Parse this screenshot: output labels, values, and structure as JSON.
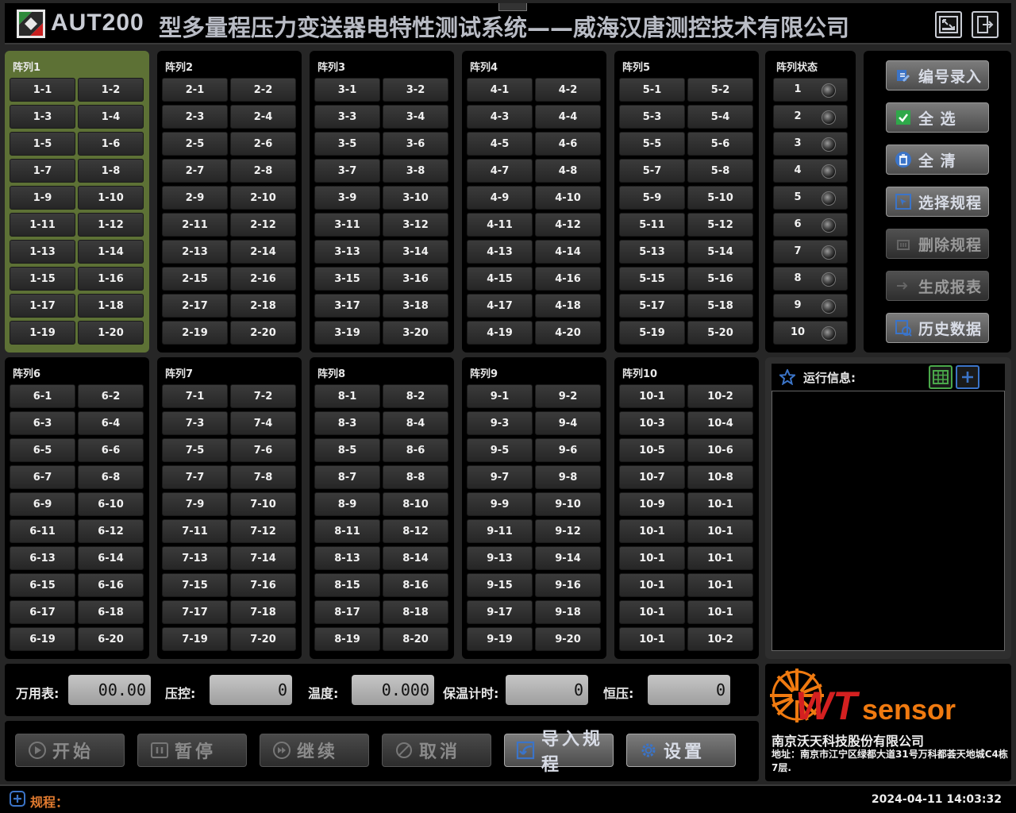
{
  "header": {
    "app_name": "AUT200",
    "title": "型多量程压力变送器电特性测试系统——威海汉唐测控技术有限公司"
  },
  "arrays": [
    {
      "title": "阵列1",
      "active": true,
      "cells": [
        "1-1",
        "1-2",
        "1-3",
        "1-4",
        "1-5",
        "1-6",
        "1-7",
        "1-8",
        "1-9",
        "1-10",
        "1-11",
        "1-12",
        "1-13",
        "1-14",
        "1-15",
        "1-16",
        "1-17",
        "1-18",
        "1-19",
        "1-20"
      ]
    },
    {
      "title": "阵列2",
      "active": false,
      "cells": [
        "2-1",
        "2-2",
        "2-3",
        "2-4",
        "2-5",
        "2-6",
        "2-7",
        "2-8",
        "2-9",
        "2-10",
        "2-11",
        "2-12",
        "2-13",
        "2-14",
        "2-15",
        "2-16",
        "2-17",
        "2-18",
        "2-19",
        "2-20"
      ]
    },
    {
      "title": "阵列3",
      "active": false,
      "cells": [
        "3-1",
        "3-2",
        "3-3",
        "3-4",
        "3-5",
        "3-6",
        "3-7",
        "3-8",
        "3-9",
        "3-10",
        "3-11",
        "3-12",
        "3-13",
        "3-14",
        "3-15",
        "3-16",
        "3-17",
        "3-18",
        "3-19",
        "3-20"
      ]
    },
    {
      "title": "阵列4",
      "active": false,
      "cells": [
        "4-1",
        "4-2",
        "4-3",
        "4-4",
        "4-5",
        "4-6",
        "4-7",
        "4-8",
        "4-9",
        "4-10",
        "4-11",
        "4-12",
        "4-13",
        "4-14",
        "4-15",
        "4-16",
        "4-17",
        "4-18",
        "4-19",
        "4-20"
      ]
    },
    {
      "title": "阵列5",
      "active": false,
      "cells": [
        "5-1",
        "5-2",
        "5-3",
        "5-4",
        "5-5",
        "5-6",
        "5-7",
        "5-8",
        "5-9",
        "5-10",
        "5-11",
        "5-12",
        "5-13",
        "5-14",
        "5-15",
        "5-16",
        "5-17",
        "5-18",
        "5-19",
        "5-20"
      ]
    },
    {
      "title": "阵列6",
      "active": false,
      "cells": [
        "6-1",
        "6-2",
        "6-3",
        "6-4",
        "6-5",
        "6-6",
        "6-7",
        "6-8",
        "6-9",
        "6-10",
        "6-11",
        "6-12",
        "6-13",
        "6-14",
        "6-15",
        "6-16",
        "6-17",
        "6-18",
        "6-19",
        "6-20"
      ]
    },
    {
      "title": "阵列7",
      "active": false,
      "cells": [
        "7-1",
        "7-2",
        "7-3",
        "7-4",
        "7-5",
        "7-6",
        "7-7",
        "7-8",
        "7-9",
        "7-10",
        "7-11",
        "7-12",
        "7-13",
        "7-14",
        "7-15",
        "7-16",
        "7-17",
        "7-18",
        "7-19",
        "7-20"
      ]
    },
    {
      "title": "阵列8",
      "active": false,
      "cells": [
        "8-1",
        "8-2",
        "8-3",
        "8-4",
        "8-5",
        "8-6",
        "8-7",
        "8-8",
        "8-9",
        "8-10",
        "8-11",
        "8-12",
        "8-13",
        "8-14",
        "8-15",
        "8-16",
        "8-17",
        "8-18",
        "8-19",
        "8-20"
      ]
    },
    {
      "title": "阵列9",
      "active": false,
      "cells": [
        "9-1",
        "9-2",
        "9-3",
        "9-4",
        "9-5",
        "9-6",
        "9-7",
        "9-8",
        "9-9",
        "9-10",
        "9-11",
        "9-12",
        "9-13",
        "9-14",
        "9-15",
        "9-16",
        "9-17",
        "9-18",
        "9-19",
        "9-20"
      ]
    },
    {
      "title": "阵列10",
      "active": false,
      "cells": [
        "10-1",
        "10-2",
        "10-3",
        "10-4",
        "10-5",
        "10-6",
        "10-7",
        "10-8",
        "10-9",
        "10-1",
        "10-1",
        "10-1",
        "10-1",
        "10-1",
        "10-1",
        "10-1",
        "10-1",
        "10-1",
        "10-1",
        "10-2"
      ]
    }
  ],
  "status": {
    "title": "阵列状态",
    "rows": [
      "1",
      "2",
      "3",
      "4",
      "5",
      "6",
      "7",
      "8",
      "9",
      "10"
    ]
  },
  "actions": [
    {
      "label": "编号录入",
      "icon": "edit-icon",
      "enabled": true,
      "color": "#3b74c8"
    },
    {
      "label": "全 选",
      "icon": "checkbox-icon",
      "enabled": true,
      "color": "#2fa84a"
    },
    {
      "label": "全 清",
      "icon": "trash-icon",
      "enabled": true,
      "color": "#3b74c8"
    },
    {
      "label": "选择规程",
      "icon": "select-icon",
      "enabled": true,
      "color": "#3b74c8"
    },
    {
      "label": "删除规程",
      "icon": "delete-icon",
      "enabled": false,
      "color": "#666666"
    },
    {
      "label": "生成报表",
      "icon": "report-icon",
      "enabled": false,
      "color": "#666666"
    },
    {
      "label": "历史数据",
      "icon": "history-icon",
      "enabled": true,
      "color": "#3b74c8"
    }
  ],
  "info": {
    "title": "运行信息:"
  },
  "readings": {
    "multimeter_label": "万用表:",
    "multimeter_value": "00.00",
    "pressure_label": "压控:",
    "pressure_value": "0",
    "temperature_label": "温度:",
    "temperature_value": "0.000",
    "hold_timer_label": "保温计时:",
    "hold_timer_value": "0",
    "constant_pressure_label": "恒压:",
    "constant_pressure_value": "0"
  },
  "controls": [
    {
      "label": "开始",
      "icon": "play-icon",
      "enabled": false
    },
    {
      "label": "暂停",
      "icon": "pause-icon",
      "enabled": false
    },
    {
      "label": "继续",
      "icon": "resume-icon",
      "enabled": false
    },
    {
      "label": "取消",
      "icon": "cancel-icon",
      "enabled": false
    },
    {
      "label": "导入规程",
      "icon": "import-icon",
      "enabled": true
    },
    {
      "label": "设置",
      "icon": "settings-icon",
      "enabled": true
    }
  ],
  "company": {
    "logo_text": "WTsensor",
    "name": "南京沃天科技股份有限公司",
    "address": "地址：南京市江宁区绿都大道31号万科都荟天地城C4栋7层."
  },
  "statusbar": {
    "procedure_label": "规程：",
    "datetime": "2024-04-11 14:03:32"
  },
  "colors": {
    "active_panel": "#5d7135",
    "accent_blue": "#3b74c8",
    "accent_green": "#2fa84a",
    "procedure_orange": "#e07a2f",
    "logo_orange": "#f07a10",
    "logo_red": "#d42020"
  }
}
